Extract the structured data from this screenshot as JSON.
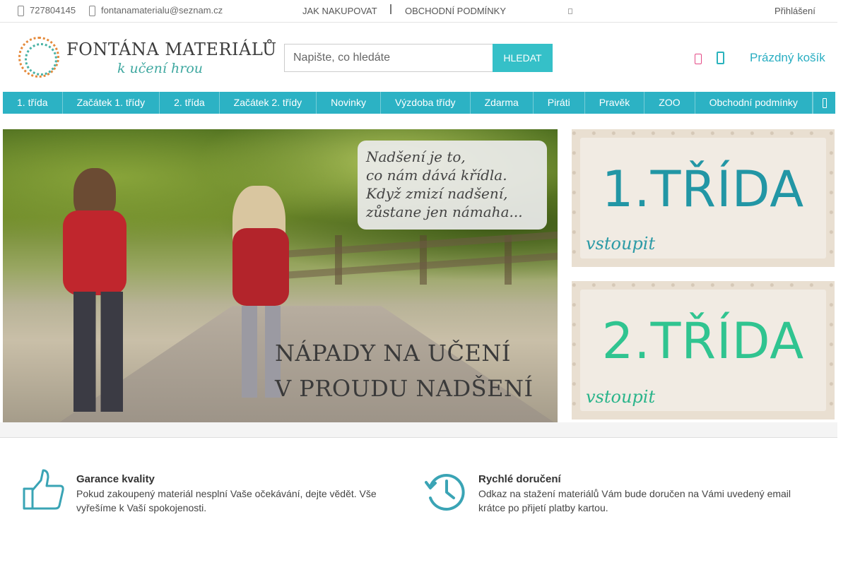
{
  "topbar": {
    "phone": "727804145",
    "email": "fontanamaterialu@seznam.cz",
    "links": [
      "JAK NAKUPOVAT",
      "OBCHODNÍ PODMÍNKY"
    ],
    "login": "Přihlášení"
  },
  "header": {
    "logo_title": "FONTÁNA MATERIÁLŮ",
    "logo_subtitle": "k učení hrou",
    "search_placeholder": "Napište, co hledáte",
    "search_button": "HLEDAT",
    "cart_label": "Prázdný košík"
  },
  "nav": {
    "items": [
      "1. třída",
      "Začátek 1. třídy",
      "2. třída",
      "Začátek 2. třídy",
      "Novinky",
      "Výzdoba třídy",
      "Zdarma",
      "Piráti",
      "Pravěk",
      "ZOO",
      "Obchodní podmínky"
    ]
  },
  "hero": {
    "quote_lines": [
      "Nadšení je to,",
      "co nám dává křídla.",
      "Když zmizí nadšení,",
      "zůstane jen námaha..."
    ],
    "banner_lines": [
      "NÁPADY NA UČENÍ",
      "V PROUDU NADŠENÍ"
    ]
  },
  "promos": [
    {
      "title": "1.TŘÍDA",
      "enter": "vstoupit",
      "color": "#2296a5"
    },
    {
      "title": "2.TŘÍDA",
      "enter": "vstoupit",
      "color": "#30c490"
    }
  ],
  "features": [
    {
      "title": "Garance kvality",
      "text": "Pokud zakoupený materiál nesplní Vaše očekávání, dejte vědět. Vše vyřešíme k Vaší spokojenosti.",
      "icon": "thumbs-up-icon"
    },
    {
      "title": "Rychlé doručení",
      "text": "Odkaz na stažení materiálů Vám bude doručen na Vámi uvedený email krátce po přijetí platby kartou.",
      "icon": "history-clock-icon"
    }
  ],
  "colors": {
    "accent": "#2cb2c4",
    "search_button": "#35c0c8",
    "wishlist": "#e44a86",
    "promo1": "#2296a5",
    "promo2": "#30c490"
  }
}
